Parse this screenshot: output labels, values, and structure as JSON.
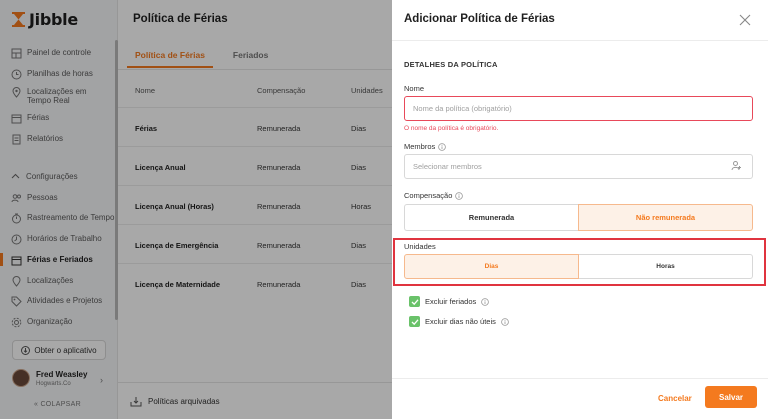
{
  "brand": {
    "name": "Jibble",
    "accent": "#f47a1f"
  },
  "sidebar": {
    "items": [
      {
        "label": "Painel de controle",
        "icon": "dashboard-icon"
      },
      {
        "label": "Planilhas de horas",
        "icon": "clock-icon"
      },
      {
        "label": "Localizações em Tempo Real",
        "icon": "location-icon"
      },
      {
        "label": "Férias",
        "icon": "calendar-icon"
      },
      {
        "label": "Relatórios",
        "icon": "report-icon"
      }
    ],
    "config_group": "Configurações",
    "config_items": [
      {
        "label": "Pessoas",
        "icon": "people-icon"
      },
      {
        "label": "Rastreamento de Tempo",
        "icon": "timer-icon"
      },
      {
        "label": "Horários de Trabalho",
        "icon": "schedule-icon"
      },
      {
        "label": "Férias e Feriados",
        "icon": "holiday-icon",
        "active": true
      },
      {
        "label": "Localizações",
        "icon": "location-icon"
      },
      {
        "label": "Atividades e Projetos",
        "icon": "tag-icon"
      },
      {
        "label": "Organização",
        "icon": "gear-icon"
      }
    ],
    "get_app": "Obter o aplicativo",
    "user": {
      "name": "Fred Weasley",
      "org": "Hogwarts.Co"
    },
    "collapse": "COLAPSAR"
  },
  "main": {
    "title": "Política de Férias",
    "tabs": [
      {
        "label": "Política de Férias",
        "active": true
      },
      {
        "label": "Feriados",
        "active": false
      }
    ],
    "columns": [
      "Nome",
      "Compensação",
      "Unidades"
    ],
    "rows": [
      [
        "Férias",
        "Remunerada",
        "Dias"
      ],
      [
        "Licença Anual",
        "Remunerada",
        "Dias"
      ],
      [
        "Licença Anual (Horas)",
        "Remunerada",
        "Horas"
      ],
      [
        "Licença de Emergência",
        "Remunerada",
        "Dias"
      ],
      [
        "Licença de Maternidade",
        "Remunerada",
        "Dias"
      ]
    ],
    "archived": "Políticas arquivadas"
  },
  "panel": {
    "title": "Adicionar Política de Férias",
    "section": "DETALHES DA POLÍTICA",
    "name_label": "Nome",
    "name_value": "",
    "name_placeholder": "Nome da política (obrigatório)",
    "name_error": "O nome da política é obrigatório.",
    "members_label": "Membros",
    "members_placeholder": "Selecionar membros",
    "compensation_label": "Compensação",
    "compensation_options": [
      "Remunerada",
      "Não remunerada"
    ],
    "compensation_selected": "Não remunerada",
    "units_label": "Unidades",
    "units_options": [
      "Dias",
      "Horas"
    ],
    "units_selected": "Dias",
    "exclude_holidays": "Excluir feriados",
    "exclude_nonworking": "Excluir dias não úteis",
    "cancel": "Cancelar",
    "save": "Salvar"
  }
}
